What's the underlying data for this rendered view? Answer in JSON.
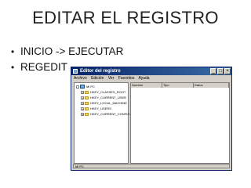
{
  "slide": {
    "title": "EDITAR EL REGISTRO",
    "bullets": [
      "INICIO -> EJECUTAR",
      "REGEDIT"
    ]
  },
  "window": {
    "title": "Editor del registro",
    "menu": [
      "Archivo",
      "Edición",
      "Ver",
      "Favoritos",
      "Ayuda"
    ],
    "tree": {
      "root": "Mi PC",
      "items": [
        "HKEY_CLASSES_ROOT",
        "HKEY_CURRENT_USER",
        "HKEY_LOCAL_MACHINE",
        "HKEY_USERS",
        "HKEY_CURRENT_CONFIG"
      ]
    },
    "columns": [
      "Nombre",
      "Tipo",
      "Datos"
    ],
    "status": "Mi PC"
  }
}
